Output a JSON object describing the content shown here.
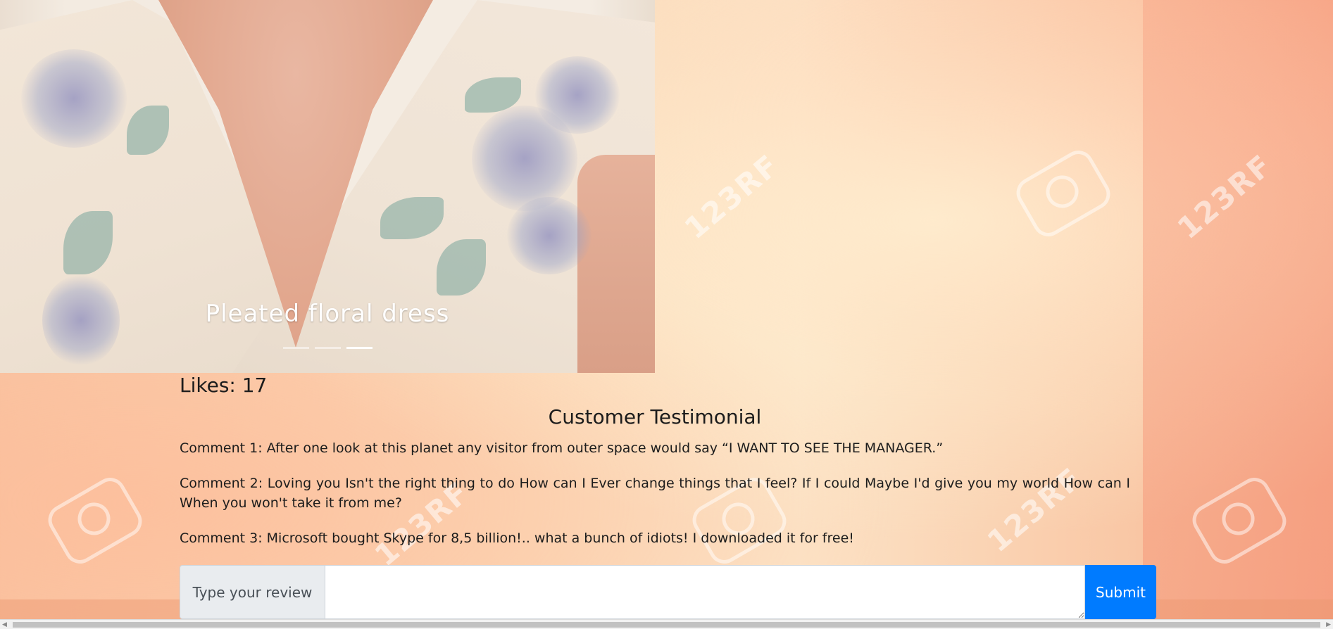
{
  "carousel": {
    "caption": "Pleated floral dress",
    "indicator_count": 3,
    "active_indicator": 3
  },
  "likes": {
    "text": "Likes: 17"
  },
  "testimonials": {
    "title": "Customer Testimonial",
    "comments": [
      "Comment 1: After one look at this planet any visitor from outer space would say “I WANT TO SEE THE MANAGER.”",
      "Comment 2: Loving you Isn't the right thing to do How can I Ever change things that I feel? If I could Maybe I'd give you my world How can I When you won't take it from me?",
      "Comment 3: Microsoft bought Skype for 8,5 billion!.. what a bunch of idiots! I downloaded it for free!"
    ]
  },
  "review_form": {
    "label": "Type your review",
    "input_value": "",
    "submit_label": "Submit"
  },
  "colors": {
    "submit_bg": "#007bff",
    "label_bg": "#e9ecef",
    "text": "#1c1c1c"
  },
  "icons": {
    "scroll_left": "triangle-left-icon",
    "scroll_right": "triangle-right-icon"
  }
}
